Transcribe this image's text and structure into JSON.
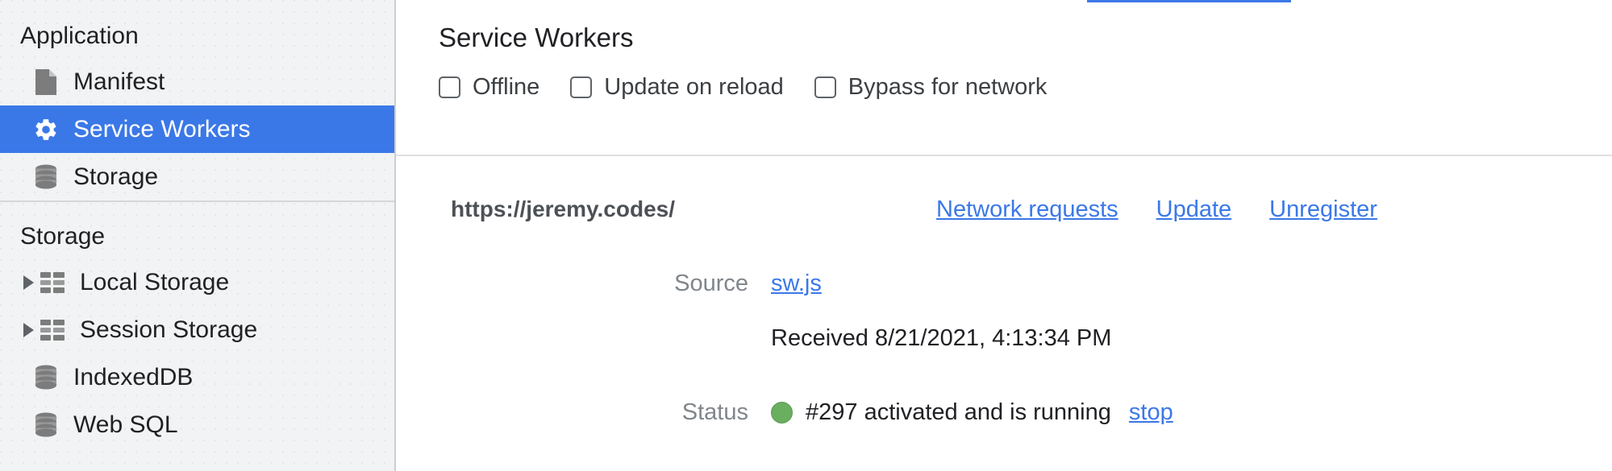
{
  "sidebar": {
    "groups": [
      {
        "title": "Application",
        "items": [
          {
            "label": "Manifest",
            "icon": "document-icon",
            "selected": false,
            "expandable": false
          },
          {
            "label": "Service Workers",
            "icon": "gear-icon",
            "selected": true,
            "expandable": false
          },
          {
            "label": "Storage",
            "icon": "database-icon",
            "selected": false,
            "expandable": false
          }
        ]
      },
      {
        "title": "Storage",
        "items": [
          {
            "label": "Local Storage",
            "icon": "table-icon",
            "selected": false,
            "expandable": true
          },
          {
            "label": "Session Storage",
            "icon": "table-icon",
            "selected": false,
            "expandable": true
          },
          {
            "label": "IndexedDB",
            "icon": "database-icon",
            "selected": false,
            "expandable": false
          },
          {
            "label": "Web SQL",
            "icon": "database-icon",
            "selected": false,
            "expandable": false
          }
        ]
      }
    ]
  },
  "main": {
    "title": "Service Workers",
    "checkboxes": [
      {
        "label": "Offline",
        "checked": false
      },
      {
        "label": "Update on reload",
        "checked": false
      },
      {
        "label": "Bypass for network",
        "checked": false
      }
    ],
    "registration": {
      "scope": "https://jeremy.codes/",
      "actions": [
        {
          "label": "Network requests"
        },
        {
          "label": "Update"
        },
        {
          "label": "Unregister"
        }
      ],
      "source_label": "Source",
      "source_file": "sw.js",
      "received_text": "Received 8/21/2021, 4:13:34 PM",
      "status_label": "Status",
      "status_text": "#297 activated and is running",
      "status_action": "stop",
      "status_color": "#6aae5f"
    }
  },
  "colors": {
    "accent": "#3b78e7",
    "sidebar_bg": "#f1f3f4",
    "link": "#3b78e7",
    "status_green": "#6aae5f"
  }
}
